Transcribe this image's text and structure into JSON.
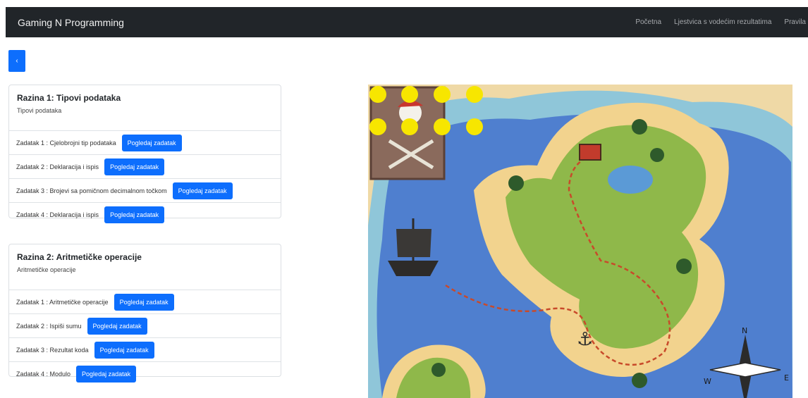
{
  "navbar": {
    "brand": "Gaming N Programming",
    "links": [
      "Početna",
      "Ljestvica s vodećim rezultatima",
      "Pravila"
    ]
  },
  "back_button": {
    "label": "‹"
  },
  "levels": [
    {
      "title": "Razina 1: Tipovi podataka",
      "subtitle": "Tipovi podataka",
      "tasks": [
        {
          "label": "Zadatak 1 : Cjelobrojni tip podataka",
          "button": "Pogledaj zadatak"
        },
        {
          "label": "Zadatak 2 : Deklaracija i ispis",
          "button": "Pogledaj zadatak"
        },
        {
          "label": "Zadatak 3 : Brojevi sa pomičnom decimalnom točkom",
          "button": "Pogledaj zadatak"
        },
        {
          "label": "Zadatak 4 : Deklaracija i ispis",
          "button": "Pogledaj zadatak"
        }
      ]
    },
    {
      "title": "Razina 2: Aritmetičke operacije",
      "subtitle": "Aritmetičke operacije",
      "tasks": [
        {
          "label": "Zadatak 1 : Aritmetičke operacije",
          "button": "Pogledaj zadatak"
        },
        {
          "label": "Zadatak 2 : Ispiši sumu",
          "button": "Pogledaj zadatak"
        },
        {
          "label": "Zadatak 3 : Rezultat koda",
          "button": "Pogledaj zadatak"
        },
        {
          "label": "Zadatak 4 : Modulo",
          "button": "Pogledaj zadatak"
        }
      ]
    }
  ],
  "map": {
    "compass_letters": {
      "north": "N",
      "west": "W",
      "east": "E"
    },
    "markers_total": 8,
    "marker_color": "#f7e600"
  },
  "colors": {
    "navbar": "#212529",
    "primary": "#0d6efd",
    "sea": "#4f7fcf",
    "sand": "#f2d38e",
    "land": "#8fb84a"
  }
}
